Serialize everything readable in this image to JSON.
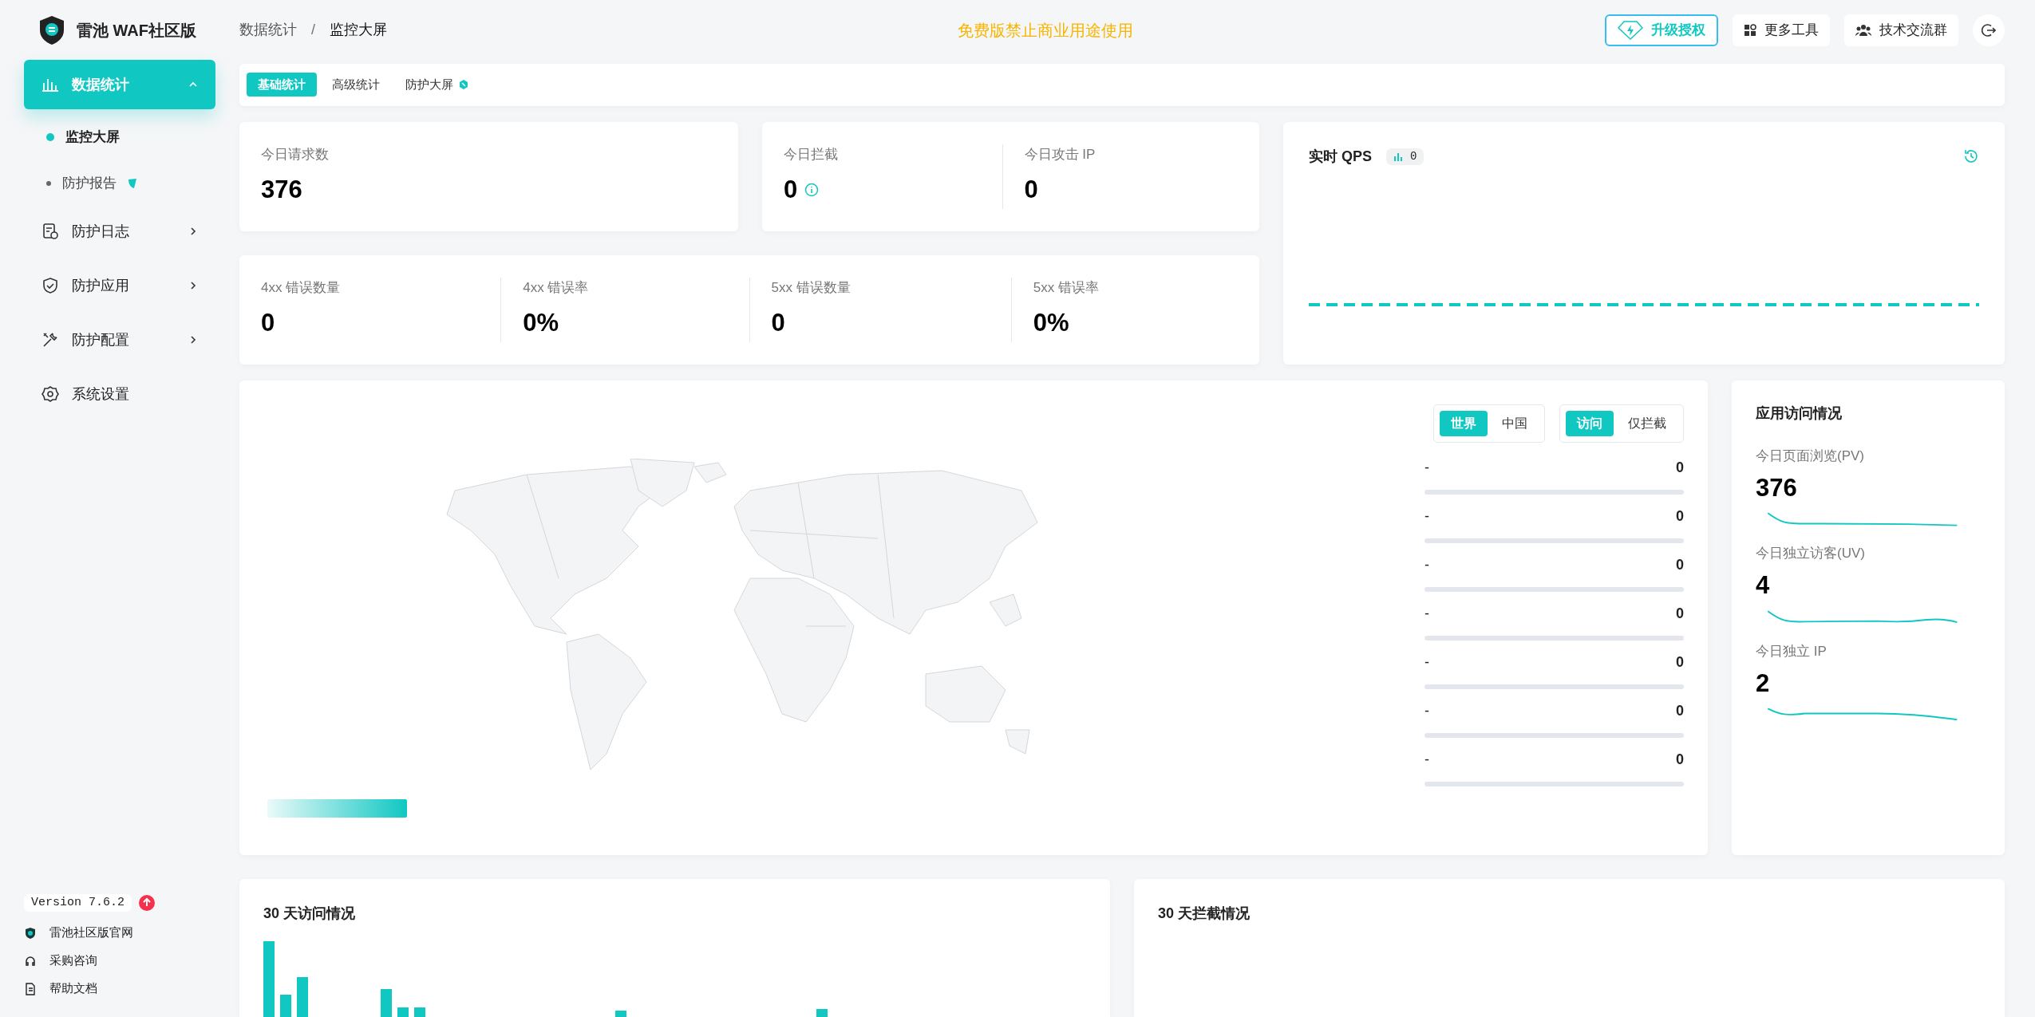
{
  "brand": {
    "title": "雷池 WAF社区版"
  },
  "breadcrumb": [
    "数据统计",
    "监控大屏"
  ],
  "breadcrumb_separator": "/",
  "notice": "免费版禁止商业用途使用",
  "header_buttons": [
    {
      "kind": "upgrade",
      "label": "升级授权"
    },
    {
      "kind": "tools",
      "label": "更多工具"
    },
    {
      "kind": "group",
      "label": "技术交流群"
    },
    {
      "kind": "logout"
    }
  ],
  "sidebar": {
    "items": [
      {
        "label": "数据统计",
        "selected": true,
        "expanded": true,
        "children": [
          {
            "label": "监控大屏",
            "selected": true
          },
          {
            "label": "防护报告",
            "selected": false,
            "badge": true
          }
        ]
      },
      {
        "label": "防护日志",
        "selected": false,
        "expanded": false
      },
      {
        "label": "防护应用",
        "selected": false,
        "expanded": false
      },
      {
        "label": "防护配置",
        "selected": false,
        "expanded": false
      },
      {
        "label": "系统设置",
        "selected": false
      }
    ],
    "version": "Version 7.6.2",
    "links": [
      "雷池社区版官网",
      "采购咨询",
      "帮助文档"
    ]
  },
  "tabs": [
    {
      "label": "基础统计",
      "selected": true
    },
    {
      "label": "高级统计",
      "selected": false
    },
    {
      "label": "防护大屏",
      "selected": false,
      "badge": true
    }
  ],
  "stat_cards": [
    {
      "items": [
        {
          "label": "今日请求数",
          "value": "376"
        }
      ]
    },
    {
      "items": [
        {
          "label": "今日拦截",
          "value": "0",
          "info": true
        },
        {
          "label": "今日攻击 IP",
          "value": "0"
        }
      ]
    },
    {
      "items": [
        {
          "label": "4xx 错误数量",
          "value": "0"
        },
        {
          "label": "4xx 错误率",
          "value": "0%"
        },
        {
          "label": "5xx 错误数量",
          "value": "0"
        },
        {
          "label": "5xx 错误率",
          "value": "0%"
        }
      ]
    }
  ],
  "qps": {
    "title": "实时 QPS",
    "badge": "0"
  },
  "map": {
    "scope_toggle": [
      {
        "label": "世界",
        "selected": true
      },
      {
        "label": "中国",
        "selected": false
      }
    ],
    "mode_toggle": [
      {
        "label": "访问",
        "selected": true
      },
      {
        "label": "仅拦截",
        "selected": false
      }
    ],
    "ranking": [
      {
        "name": "-",
        "value": "0",
        "level": 0
      },
      {
        "name": "-",
        "value": "0",
        "level": 0
      },
      {
        "name": "-",
        "value": "0",
        "level": 0
      },
      {
        "name": "-",
        "value": "0",
        "level": 0
      },
      {
        "name": "-",
        "value": "0",
        "level": 0
      },
      {
        "name": "-",
        "value": "0",
        "level": 0
      },
      {
        "name": "-",
        "value": "0",
        "level": 0
      }
    ]
  },
  "app_access": {
    "title": "应用访问情况",
    "metrics": [
      {
        "label": "今日页面浏览(PV)",
        "value": "376"
      },
      {
        "label": "今日独立访客(UV)",
        "value": "4"
      },
      {
        "label": "今日独立 IP",
        "value": "2"
      }
    ]
  },
  "charts": [
    {
      "title": "30 天访问情况",
      "kind": "bars"
    },
    {
      "title": "30 天拦截情况",
      "kind": "empty"
    }
  ]
}
